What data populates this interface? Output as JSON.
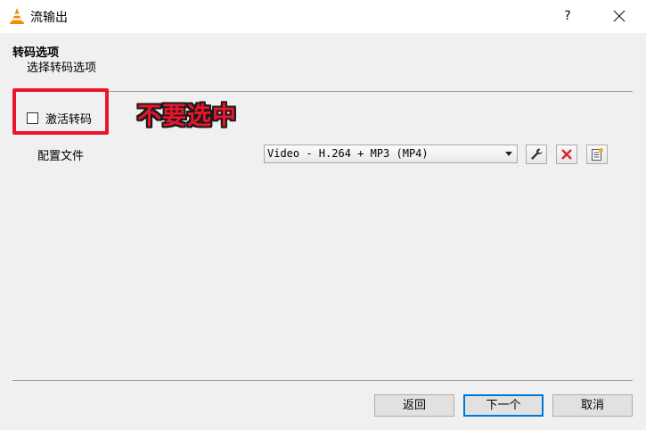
{
  "window": {
    "title": "流输出",
    "help_label": "?",
    "icons": {
      "app": "vlc-cone-icon",
      "close": "close-icon"
    }
  },
  "header": {
    "title": "转码选项",
    "subtitle": "选择转码选项"
  },
  "transcode": {
    "activate_label": "激活转码",
    "activate_checked": false,
    "annotation": "不要选中",
    "annotation_color": "#e8152c"
  },
  "profile": {
    "label": "配置文件",
    "selected": "Video - H.264 + MP3 (MP4)",
    "tools": [
      "wrench-icon",
      "delete-icon",
      "new-profile-icon"
    ]
  },
  "buttons": {
    "back": "返回",
    "next": "下一个",
    "cancel": "取消"
  },
  "colors": {
    "accent": "#0078d7",
    "delete_red": "#d9262c"
  }
}
